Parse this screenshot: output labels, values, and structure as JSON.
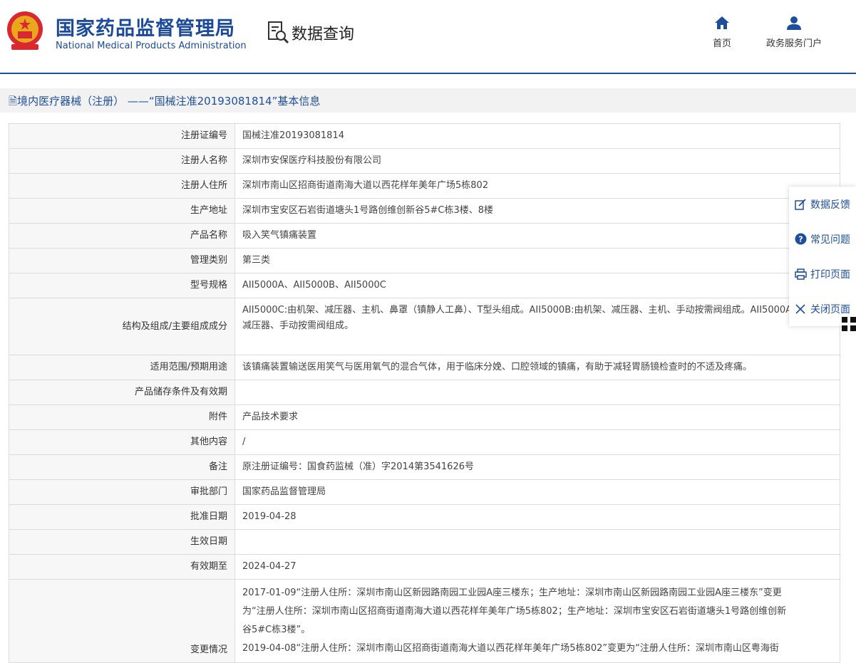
{
  "header": {
    "brand_cn": "国家药品监督管理局",
    "brand_en": "National Medical Products Administration",
    "data_query": "数据查询",
    "nav_home": "首页",
    "nav_portal": "政务服务门户"
  },
  "breadcrumb": "境内医疗器械（注册） ——“国械注准20193081814”基本信息",
  "rows": [
    {
      "label": "注册证编号",
      "value": "国械注准20193081814"
    },
    {
      "label": "注册人名称",
      "value": "深圳市安保医疗科技股份有限公司"
    },
    {
      "label": "注册人住所",
      "value": "深圳市南山区招商街道南海大道以西花样年美年广场5栋802"
    },
    {
      "label": "生产地址",
      "value": "深圳市宝安区石岩街道塘头1号路创维创新谷5#C栋3楼、8楼"
    },
    {
      "label": "产品名称",
      "value": "吸入笑气镇痛装置"
    },
    {
      "label": "管理类别",
      "value": "第三类"
    },
    {
      "label": "型号规格",
      "value": "AII5000A、AII5000B、AII5000C"
    },
    {
      "label": "结构及组成/主要组成成分",
      "value": "AII5000C:由机架、减压器、主机、鼻罩（镇静人工鼻）、T型头组成。AII5000B:由机架、减压器、主机、手动按需阀组成。AII5000A:由机架、减压器、手动按需阀组成。"
    },
    {
      "label": "适用范围/预期用途",
      "value": "该镇痛装置输送医用笑气与医用氧气的混合气体，用于临床分娩、口腔领域的镇痛，有助于减轻胃肠镜检查时的不适及疼痛。"
    },
    {
      "label": "产品储存条件及有效期",
      "value": ""
    },
    {
      "label": "附件",
      "value": "产品技术要求"
    },
    {
      "label": "其他内容",
      "value": "/"
    },
    {
      "label": "备注",
      "value": "原注册证编号：国食药监械（准）字2014第3541626号"
    },
    {
      "label": "审批部门",
      "value": "国家药品监督管理局"
    },
    {
      "label": "批准日期",
      "value": "2019-04-28"
    },
    {
      "label": "生效日期",
      "value": ""
    },
    {
      "label": "有效期至",
      "value": "2024-04-27"
    }
  ],
  "change_row": {
    "label": "变更情况",
    "lines": [
      "2017-01-09“注册人住所：深圳市南山区新园路南园工业园A座三楼东；生产地址：深圳市南山区新园路南园工业园A座三楼东”变更",
      "为“注册人住所：深圳市南山区招商街道南海大道以西花样年美年广场5栋802；生产地址：深圳市宝安区石岩街道塘头1号路创维创新",
      "谷5#C栋3楼”。",
      "2019-04-08“注册人住所：深圳市南山区招商街道南海大道以西花样年美年广场5栋802”变更为“注册人住所：深圳市南山区粤海街"
    ]
  },
  "side_panel": {
    "feedback": "数据反馈",
    "faq": "常见问题",
    "print": "打印页面",
    "close": "关闭页面"
  },
  "colors": {
    "brand_blue": "#1b4a9a",
    "link_blue": "#1f4f9c",
    "label_bg": "#f7f7f7",
    "border": "#dcdcdc"
  }
}
